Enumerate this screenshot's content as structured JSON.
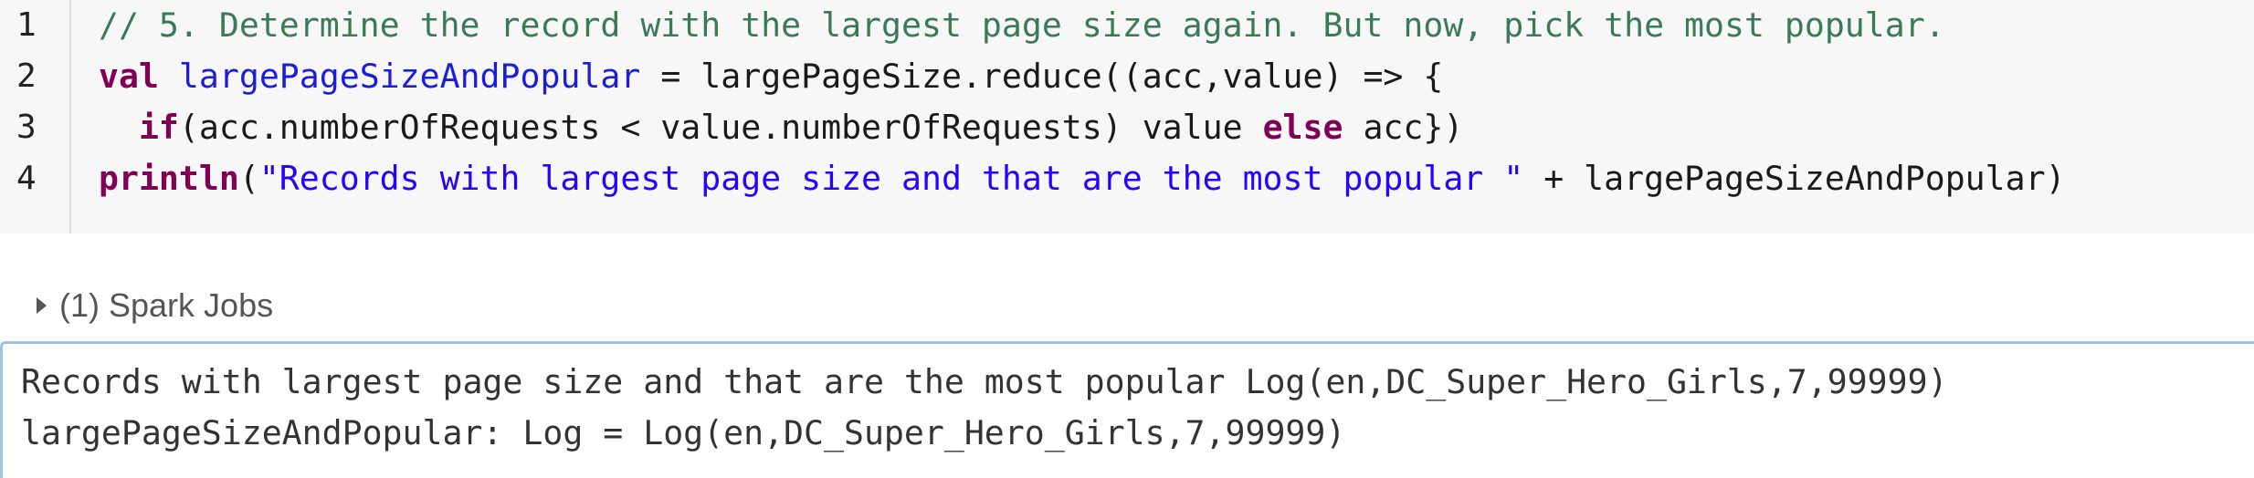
{
  "code_cell": {
    "lines": [
      {
        "number": "1",
        "tokens": [
          {
            "type": "comment",
            "text": "// 5. Determine the record with the largest page size again. But now, pick the most popular."
          }
        ]
      },
      {
        "number": "2",
        "tokens": [
          {
            "type": "keyword",
            "text": "val"
          },
          {
            "type": "plain",
            "text": " "
          },
          {
            "type": "ident",
            "text": "largePageSizeAndPopular"
          },
          {
            "type": "plain",
            "text": " = largePageSize.reduce((acc,value) => {"
          }
        ]
      },
      {
        "number": "3",
        "tokens": [
          {
            "type": "plain",
            "text": "  "
          },
          {
            "type": "keyword",
            "text": "if"
          },
          {
            "type": "plain",
            "text": "(acc.numberOfRequests < value.numberOfRequests) value "
          },
          {
            "type": "keyword",
            "text": "else"
          },
          {
            "type": "plain",
            "text": " acc})"
          }
        ]
      },
      {
        "number": "4",
        "tokens": [
          {
            "type": "keyword",
            "text": "println"
          },
          {
            "type": "plain",
            "text": "("
          },
          {
            "type": "string",
            "text": "\"Records with largest page size and that are the most popular \""
          },
          {
            "type": "plain",
            "text": " + largePageSizeAndPopular)"
          }
        ]
      }
    ]
  },
  "spark_jobs": {
    "label": "(1) Spark Jobs",
    "icon": "caret-right-icon",
    "expanded": false
  },
  "output": {
    "lines": [
      "Records with largest page size and that are the most popular Log(en,DC_Super_Hero_Girls,7,99999)",
      "largePageSizeAndPopular: Log = Log(en,DC_Super_Hero_Girls,7,99999)"
    ]
  },
  "colors": {
    "code_background": "#f7f7f7",
    "comment": "#3b7a57",
    "keyword": "#7f0055",
    "identifier": "#1c1cdb",
    "string": "#2a00ff",
    "output_border": "#9fc3e8"
  }
}
